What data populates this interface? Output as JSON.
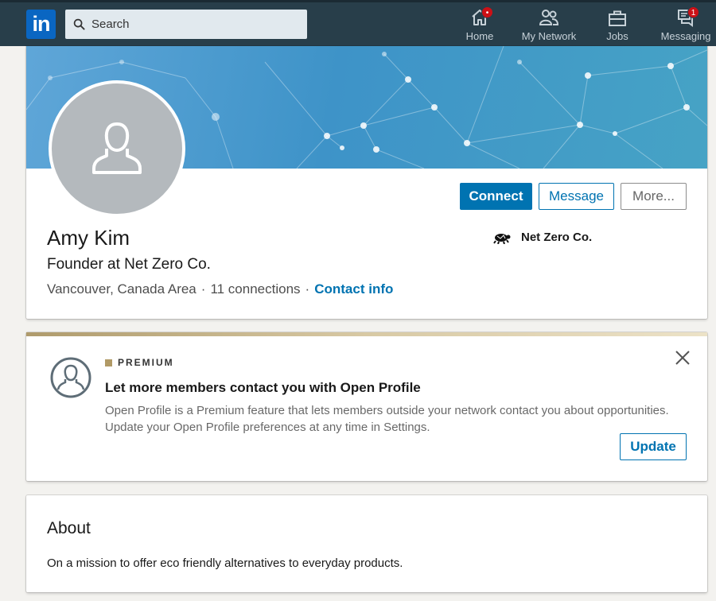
{
  "colors": {
    "nav_bg": "#283e4a",
    "brand_blue": "#0073b1",
    "premium_gold": "#b19a66",
    "notification_red": "#cc1016"
  },
  "nav": {
    "logo_text": "in",
    "search_placeholder": "Search",
    "items": [
      {
        "label": "Home",
        "icon": "home-icon",
        "badge": "•"
      },
      {
        "label": "My Network",
        "icon": "people-icon",
        "badge": ""
      },
      {
        "label": "Jobs",
        "icon": "briefcase-icon",
        "badge": ""
      },
      {
        "label": "Messaging",
        "icon": "chat-icon",
        "badge": "1"
      }
    ]
  },
  "profile": {
    "name": "Amy Kim",
    "headline": "Founder at Net Zero Co.",
    "location": "Vancouver, Canada Area",
    "separator": "·",
    "connections": "11 connections",
    "contact_info": "Contact info",
    "company": "Net Zero Co.",
    "buttons": {
      "connect": "Connect",
      "message": "Message",
      "more": "More..."
    }
  },
  "premium": {
    "tag": "PREMIUM",
    "title": "Let more members contact you with Open Profile",
    "description_line1": "Open Profile is a Premium feature that lets members outside your network contact you about opportunities.",
    "description_line2": "Update your Open Profile preferences at any time in Settings.",
    "update_button": "Update"
  },
  "about": {
    "heading": "About",
    "text": "On a mission to offer eco friendly alternatives to everyday products."
  }
}
